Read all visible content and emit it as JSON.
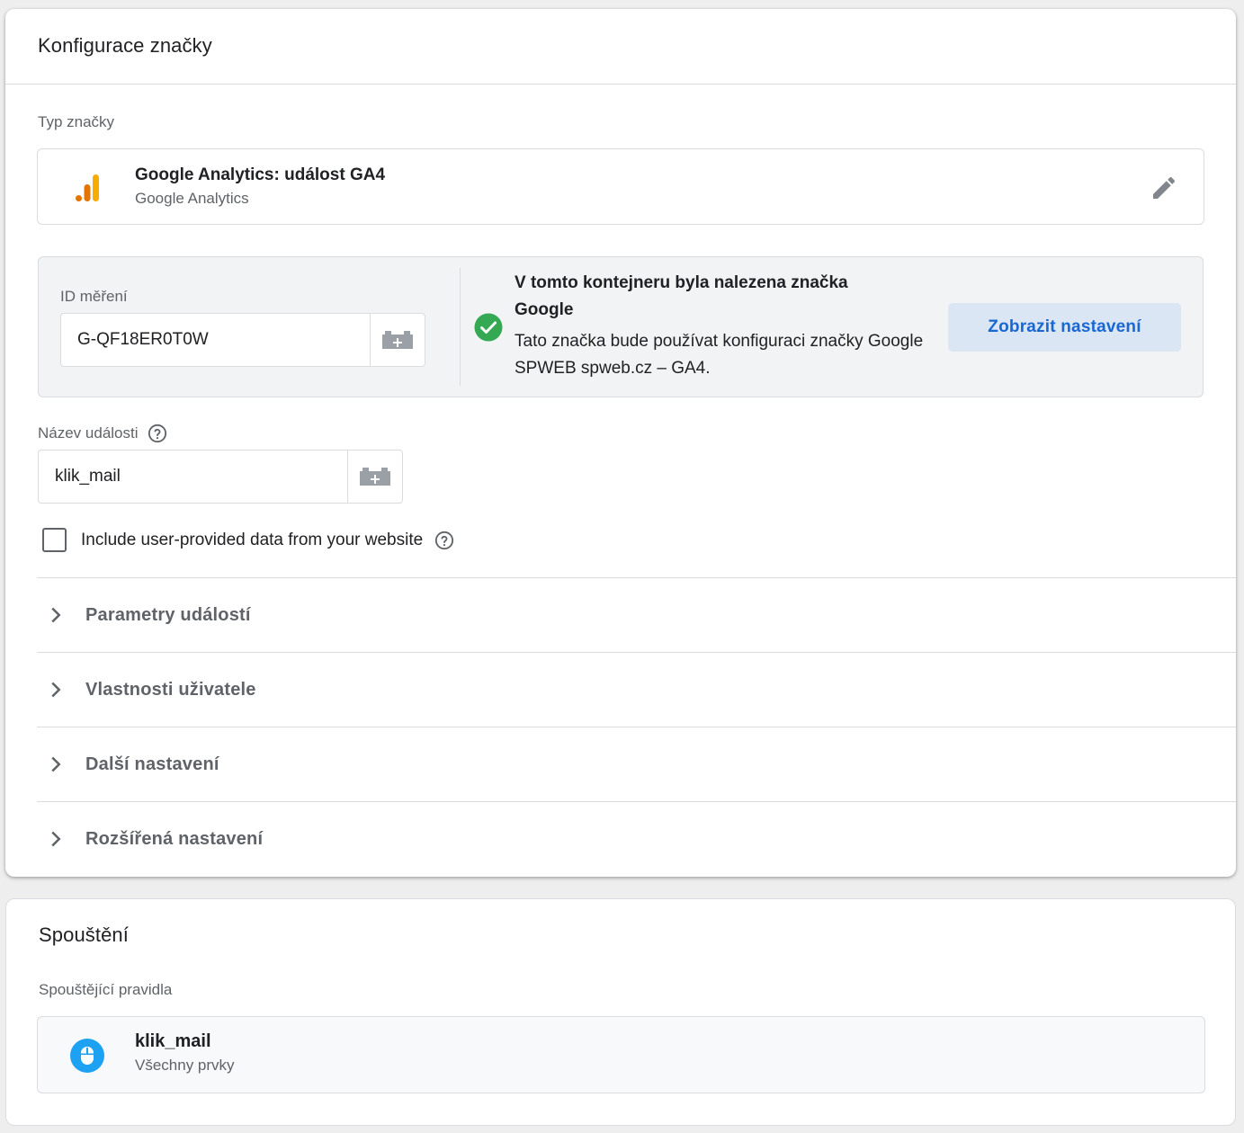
{
  "config": {
    "title": "Konfigurace značky",
    "tag_type_label": "Typ značky",
    "tag_type": {
      "name": "Google Analytics: událost GA4",
      "vendor": "Google Analytics",
      "icon": "google-analytics-icon"
    },
    "measurement": {
      "label": "ID měření",
      "value": "G-QF18ER0T0W",
      "found_title": "V tomto kontejneru byla nalezena značka Google",
      "found_desc": "Tato značka bude používat konfiguraci značky Google SPWEB spweb.cz – GA4.",
      "button_label": "Zobrazit nastavení"
    },
    "event_name": {
      "label": "Název události",
      "value": "klik_mail"
    },
    "include_user_data": {
      "label": "Include user-provided data from your website",
      "checked": false
    },
    "sections": [
      "Parametry událostí",
      "Vlastnosti uživatele",
      "Další nastavení",
      "Rozšířená nastavení"
    ]
  },
  "triggering": {
    "title": "Spouštění",
    "rules_label": "Spouštějící pravidla",
    "trigger": {
      "name": "klik_mail",
      "type": "Všechny prvky",
      "icon": "mouse-click-icon"
    }
  },
  "colors": {
    "accent_blue": "#1967d2",
    "success_green": "#34a853",
    "trigger_icon_blue": "#1da1f2",
    "ga_orange": "#f9ab00",
    "ga_dark_orange": "#e37400"
  }
}
